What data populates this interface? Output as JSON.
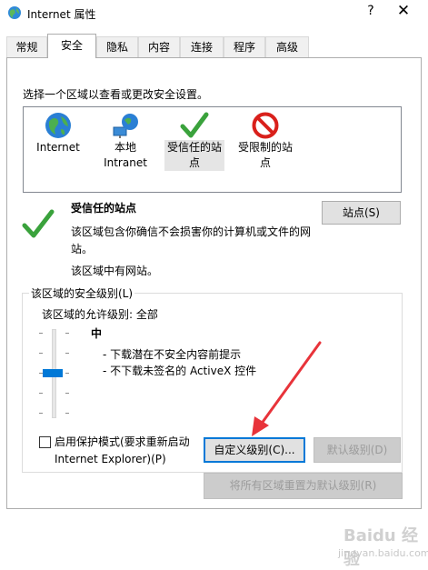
{
  "window": {
    "title": "Internet 属性",
    "help": "?",
    "close": "✕"
  },
  "tabs": [
    {
      "label": "常规"
    },
    {
      "label": "安全"
    },
    {
      "label": "隐私"
    },
    {
      "label": "内容"
    },
    {
      "label": "连接"
    },
    {
      "label": "程序"
    },
    {
      "label": "高级"
    }
  ],
  "active_tab": "安全",
  "security": {
    "zone_prompt": "选择一个区域以查看或更改安全设置。",
    "zones": [
      {
        "line1": "Internet",
        "line2": "",
        "icon": "globe-icon"
      },
      {
        "line1": "本地",
        "line2": "Intranet",
        "icon": "intranet-icon"
      },
      {
        "line1": "受信任的站",
        "line2": "点",
        "icon": "checkmark-icon"
      },
      {
        "line1": "受限制的站",
        "line2": "点",
        "icon": "restricted-icon"
      }
    ],
    "selected_zone": "受信任的站点",
    "zone_title": "受信任的站点",
    "zone_desc": "该区域包含你确信不会损害你的计算机或文件的网站。",
    "zone_extra": "该区域中有网站。",
    "sites_button": "站点(S)",
    "level_group": "该区域的安全级别(L)",
    "allowed_level": "该区域的允许级别: 全部",
    "level_name": "中",
    "level_items": [
      "- 下载潜在不安全内容前提示",
      "- 不下载未签名的 ActiveX 控件"
    ],
    "protected_mode_line1": "启用保护模式(要求重新启动",
    "protected_mode_line2": "Internet Explorer)(P)",
    "protected_mode_checked": false,
    "custom_level_button": "自定义级别(C)...",
    "default_level_button": "默认级别(D)",
    "reset_all_button": "将所有区域重置为默认级别(R)"
  },
  "watermark": {
    "brand": "Baidu 经验",
    "url": "jingyan.baidu.com"
  },
  "colors": {
    "accent": "#0078d7",
    "arrow": "#e8333a",
    "check": "#3aa23c",
    "restricted": "#d9201b"
  }
}
